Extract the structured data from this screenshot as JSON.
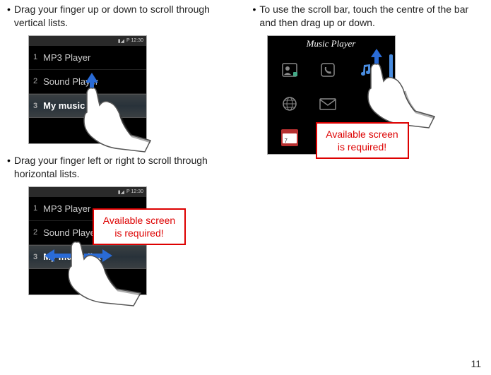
{
  "left": {
    "tip1": "Drag your finger up or down to scroll through vertical lists.",
    "tip2": "Drag your finger left or right to scroll through horizontal lists."
  },
  "right": {
    "tip1": "To use the scroll bar, touch the centre of the bar and then drag up or down."
  },
  "phone1": {
    "time": "P 12:30",
    "items": [
      {
        "num": "1",
        "label": "MP3 Player"
      },
      {
        "num": "2",
        "label": "Sound Player"
      },
      {
        "num": "3",
        "label": "My music list"
      }
    ]
  },
  "phone2": {
    "time": "P 12:30",
    "items": [
      {
        "num": "1",
        "label": "MP3 Player"
      },
      {
        "num": "2",
        "label": "Sound Player"
      },
      {
        "num": "3",
        "label": "My music list"
      }
    ]
  },
  "phone3": {
    "title": "Music Player",
    "calendar_num": "7"
  },
  "warning": {
    "line1": "Available screen",
    "line2": "is required!"
  },
  "page_number": "11"
}
